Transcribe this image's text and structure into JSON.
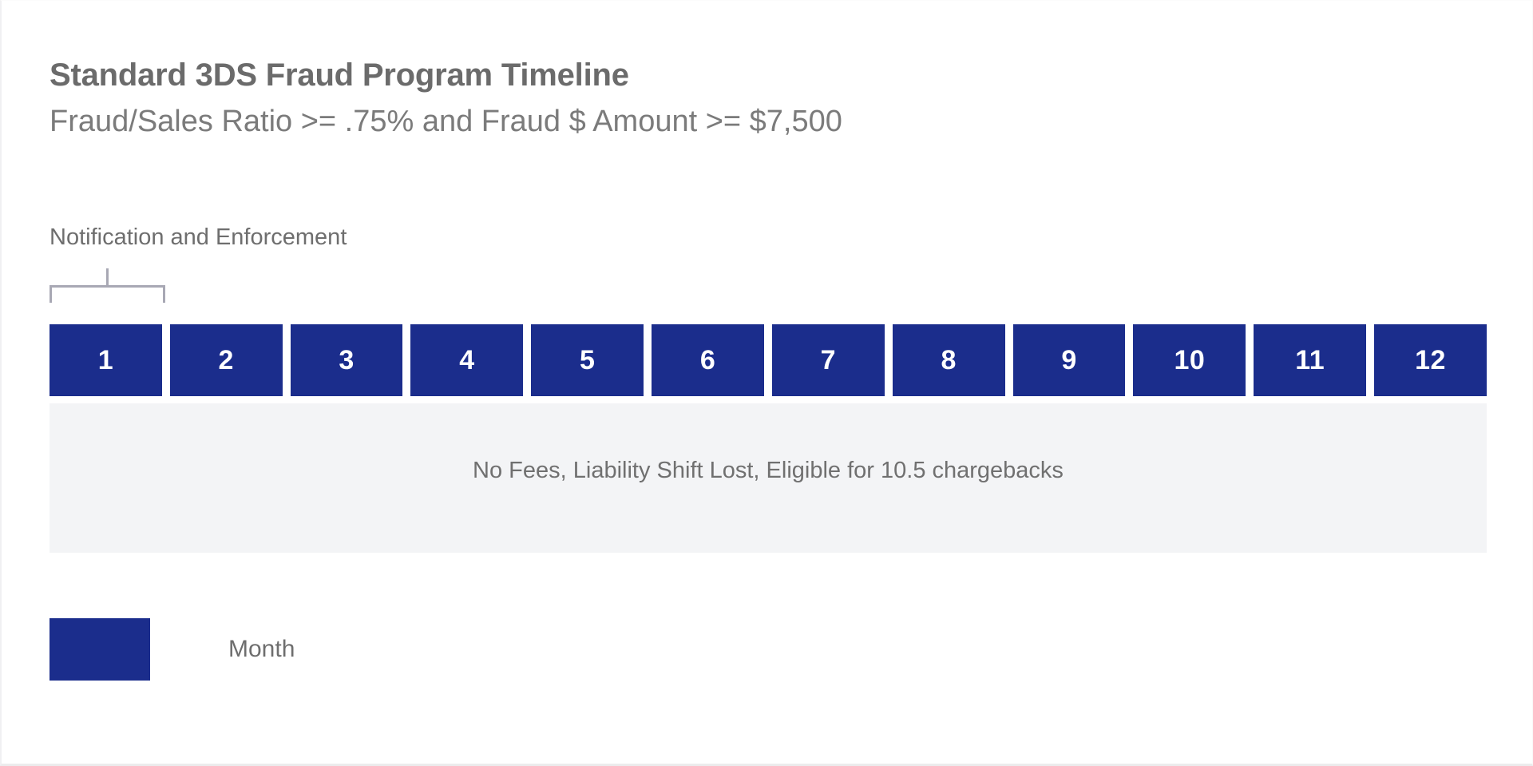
{
  "header": {
    "title": "Standard 3DS Fraud Program Timeline",
    "subtitle": "Fraud/Sales Ratio >= .75% and Fraud $ Amount >= $7,500"
  },
  "phase": {
    "label": "Notification and Enforcement",
    "bracket_spans_months": 1
  },
  "timeline": {
    "months": [
      {
        "label": "1"
      },
      {
        "label": "2"
      },
      {
        "label": "3"
      },
      {
        "label": "4"
      },
      {
        "label": "5"
      },
      {
        "label": "6"
      },
      {
        "label": "7"
      },
      {
        "label": "8"
      },
      {
        "label": "9"
      },
      {
        "label": "10"
      },
      {
        "label": "11"
      },
      {
        "label": "12"
      }
    ]
  },
  "status_panel": {
    "text": "No Fees, Liability Shift Lost, Eligible for 10.5 chargebacks"
  },
  "legend": {
    "items": [
      {
        "label": "Month",
        "color": "#1b2d8c"
      }
    ]
  },
  "colors": {
    "month_blue": "#1b2d8c",
    "panel_gray": "#f3f4f6",
    "text_gray": "#6e6e6e",
    "bracket_gray": "#a8a8b4",
    "page_background": "#ffffff"
  }
}
